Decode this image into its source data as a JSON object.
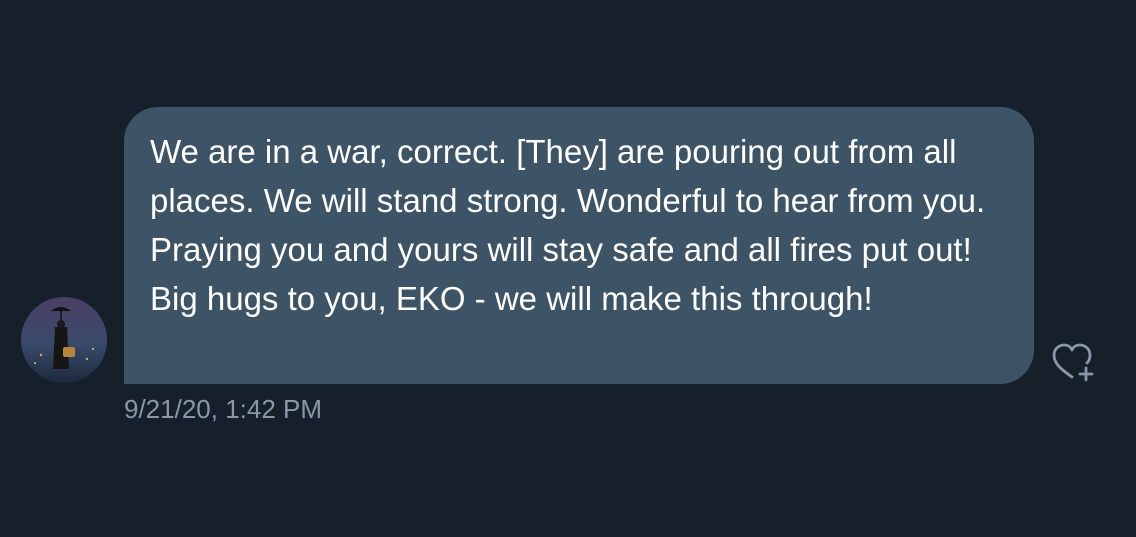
{
  "conversation": {
    "message": {
      "text": "We are in a war, correct. [They] are pouring out from all places. We will stand strong. Wonderful to hear from you. Praying you and yours will stay safe and all fires put out! Big hugs to you, EKO - we will make this through!",
      "timestamp": "9/21/20, 1:42 PM"
    },
    "avatar_icon": "sender-avatar",
    "reaction_icon": "heart-plus-icon"
  },
  "colors": {
    "background": "#15202b",
    "bubble": "#3d5466",
    "message_text": "#ffffff",
    "timestamp_text": "#8899a6",
    "icon": "#8899a6"
  }
}
